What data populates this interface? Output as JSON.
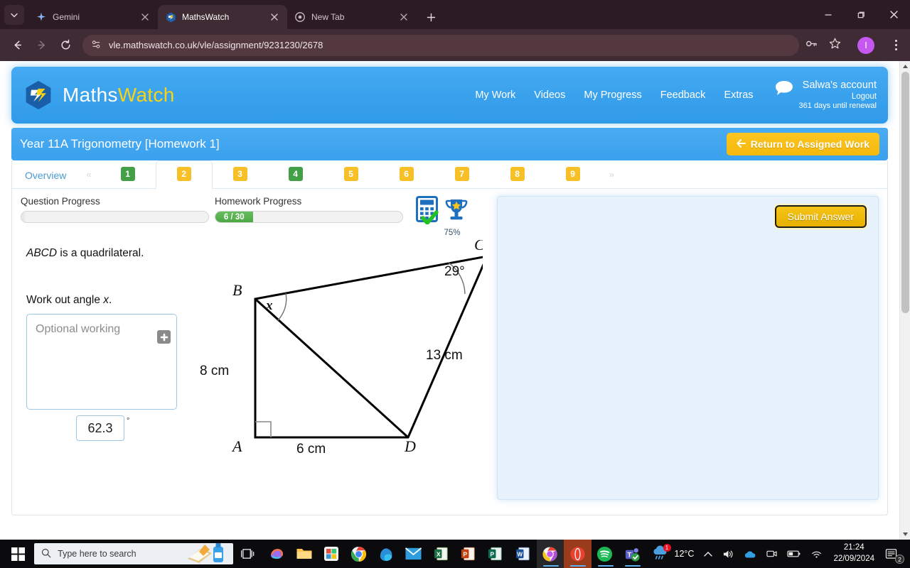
{
  "browser": {
    "tabs": [
      {
        "title": "Gemini",
        "icon": "gemini-sparkle-icon",
        "active": false
      },
      {
        "title": "MathsWatch",
        "icon": "mathswatch-icon",
        "active": true
      },
      {
        "title": "New Tab",
        "icon": "chrome-icon",
        "active": false
      }
    ],
    "url": "vle.mathswatch.co.uk/vle/assignment/9231230/2678",
    "profile_initial": "I",
    "new_tab_label": "+"
  },
  "site_header": {
    "logo_maths": "Maths",
    "logo_watch": "Watch",
    "nav": [
      {
        "label": "My Work"
      },
      {
        "label": "Videos"
      },
      {
        "label": "My Progress"
      },
      {
        "label": "Feedback"
      },
      {
        "label": "Extras"
      }
    ],
    "account_name": "Salwa's account",
    "logout": "Logout",
    "renewal": "361 days until renewal"
  },
  "assignment": {
    "title": "Year 11A Trigonometry [Homework 1]",
    "return_button": "Return to Assigned Work"
  },
  "tabs_row": {
    "overview_label": "Overview",
    "prev_arrow": "«",
    "next_arrow": "»",
    "questions": [
      {
        "label": "1",
        "state": "complete"
      },
      {
        "label": "2",
        "state": "current"
      },
      {
        "label": "3",
        "state": "todo"
      },
      {
        "label": "4",
        "state": "complete"
      },
      {
        "label": "5",
        "state": "todo"
      },
      {
        "label": "6",
        "state": "todo"
      },
      {
        "label": "7",
        "state": "todo"
      },
      {
        "label": "8",
        "state": "todo"
      },
      {
        "label": "9",
        "state": "todo"
      }
    ],
    "active_index": 1
  },
  "progress": {
    "question_label": "Question Progress",
    "question_value": "",
    "homework_label": "Homework Progress",
    "homework_value": "6 / 30",
    "homework_percent": 20,
    "score_percent": "75%"
  },
  "question": {
    "statement_italic": "ABCD",
    "statement_rest": " is a quadrilateral.",
    "instruction_pre": "Work out angle ",
    "instruction_var": "x",
    "instruction_post": ".",
    "working_placeholder": "Optional working",
    "add_button": "+",
    "answer_value": "62.3",
    "degree_symbol": "°"
  },
  "diagram": {
    "vertices": {
      "A": "A",
      "B": "B",
      "C": "C",
      "D": "D"
    },
    "labels": {
      "side_ab": "8 cm",
      "side_ad": "6 cm",
      "side_cd": "13 cm",
      "angle_c": "29°",
      "angle_b": "x"
    }
  },
  "answer_panel": {
    "submit_label": "Submit Answer"
  },
  "taskbar": {
    "search_placeholder": "Type here to search",
    "weather": "12°C",
    "time": "21:24",
    "date": "22/09/2024",
    "notification_count": "2"
  },
  "colors": {
    "brand_blue": "#45aaf2",
    "brand_yellow": "#f6d317",
    "progress_green": "#4ea845",
    "submit_gold": "#f5c518"
  }
}
